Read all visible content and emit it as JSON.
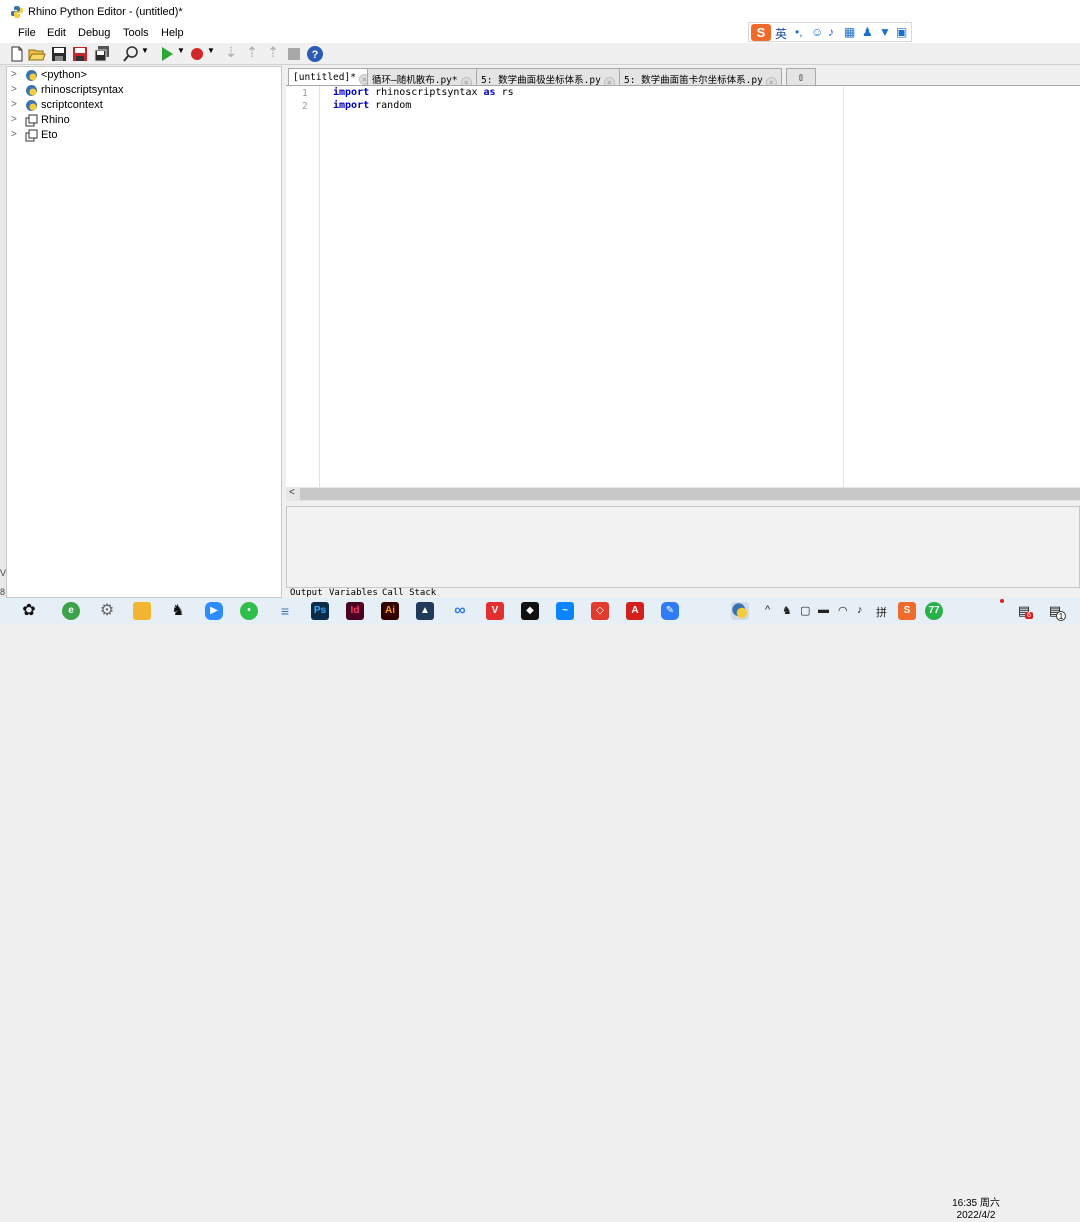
{
  "window": {
    "title": "Rhino Python Editor - (untitled)*"
  },
  "menu": [
    "File",
    "Edit",
    "Debug",
    "Tools",
    "Help"
  ],
  "ime": {
    "logo": "S",
    "mode": "英"
  },
  "tree": [
    {
      "label": "<python>",
      "icon": "python-icon"
    },
    {
      "label": "rhinoscriptsyntax",
      "icon": "python-icon"
    },
    {
      "label": "scriptcontext",
      "icon": "python-icon"
    },
    {
      "label": "Rhino",
      "icon": "namespace-icon"
    },
    {
      "label": "Eto",
      "icon": "namespace-icon"
    }
  ],
  "tabs": [
    {
      "label": "[untitled]*",
      "active": true
    },
    {
      "label": "循环—随机散布.py*",
      "active": false
    },
    {
      "label": "5: 数学曲面极坐标体系.py",
      "active": false
    },
    {
      "label": "5: 数学曲面笛卡尔坐标体系.py",
      "active": false
    }
  ],
  "editor": {
    "lines": [
      {
        "no": "1",
        "keyword": "import",
        "rest": " rhinoscriptsyntax ",
        "keyword2": "as",
        "rest2": " rs"
      },
      {
        "no": "2",
        "keyword": "import",
        "rest": " random",
        "keyword2": "",
        "rest2": ""
      }
    ]
  },
  "bottom_tabs": [
    "Output",
    "Variables",
    "Call Stack"
  ],
  "taskbar": {
    "clock_time": "16:35 周六",
    "clock_date": "2022/4/2",
    "notification_count": "1",
    "badge_count": "6",
    "tray_glyphs": [
      "^",
      "拼"
    ]
  },
  "colors": {
    "accent": "#1a6fd0",
    "keyword": "#0000c0",
    "ime_brand": "#ef6a2b"
  }
}
